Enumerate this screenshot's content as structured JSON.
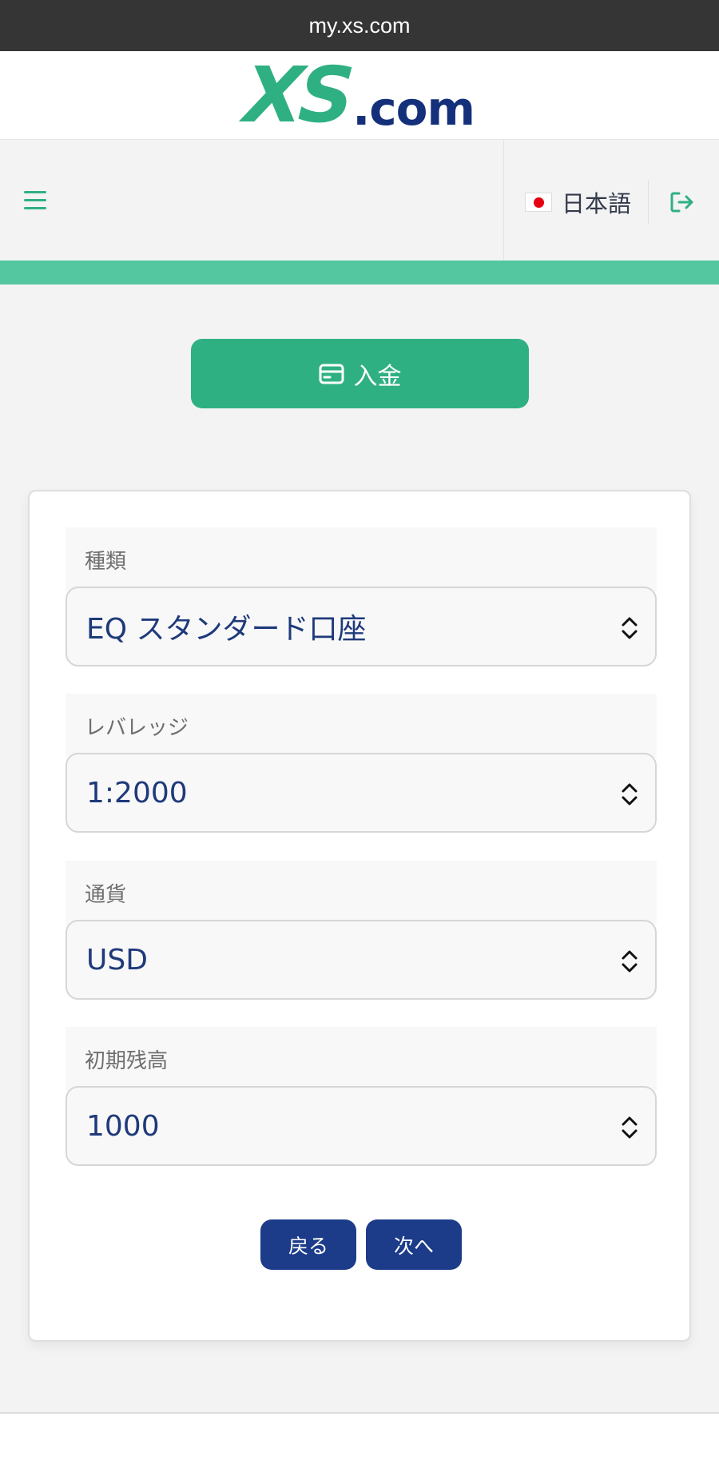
{
  "browser": {
    "url": "my.xs.com"
  },
  "logo": {
    "mark": "XS",
    "suffix": ".com"
  },
  "nav": {
    "language": "日本語"
  },
  "deposit": {
    "label": "入金"
  },
  "form": {
    "fields": [
      {
        "label": "種類",
        "value": "EQ スタンダード口座"
      },
      {
        "label": "レバレッジ",
        "value": "1:2000"
      },
      {
        "label": "通貨",
        "value": "USD"
      },
      {
        "label": "初期残高",
        "value": "1000"
      }
    ],
    "back_label": "戻る",
    "next_label": "次へ"
  },
  "colors": {
    "brand_green": "#2fb083",
    "brand_navy": "#1c3c8a",
    "progress": "#54c6a0"
  },
  "icons": {
    "menu": "hamburger-icon",
    "logout": "logout-icon",
    "deposit": "credit-card-icon",
    "select": "chevron-up-down-icon"
  }
}
